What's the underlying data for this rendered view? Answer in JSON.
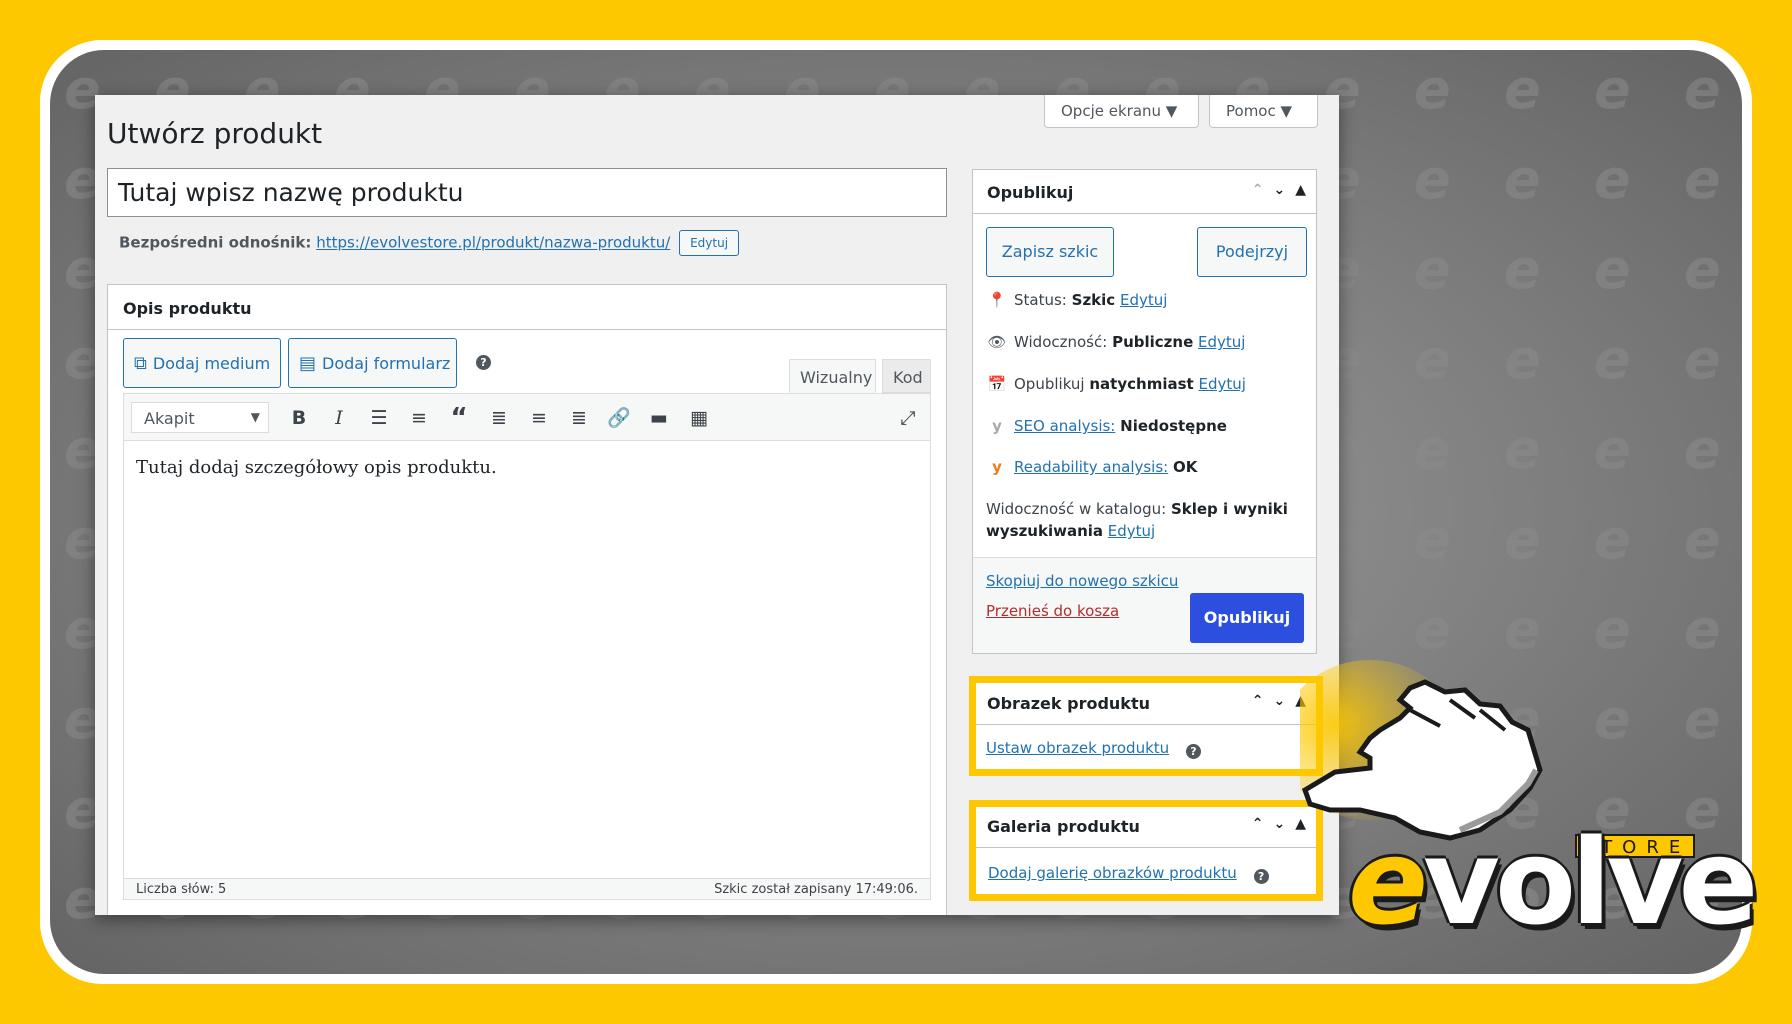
{
  "screen_options": {
    "screen_options_label": "Opcje ekranu ▼",
    "help_label": "Pomoc ▼"
  },
  "page": {
    "title": "Utwórz produkt"
  },
  "product": {
    "title_placeholder": "Tutaj wpisz nazwę produktu",
    "permalink_label": "Bezpośredni odnośnik:",
    "permalink_url": "https://evolvestore.pl/produkt/nazwa-produktu/",
    "permalink_edit": "Edytuj"
  },
  "description": {
    "heading": "Opis produktu",
    "add_media": "Dodaj medium",
    "add_form": "Dodaj formularz",
    "tab_visual": "Wizualny",
    "tab_code": "Kod",
    "format_value": "Akapit",
    "content": "Tutaj dodaj szczegółowy opis produktu.",
    "word_count": "Liczba słów: 5",
    "saved_status": "Szkic został zapisany 17:49:06."
  },
  "publish": {
    "heading": "Opublikuj",
    "save_draft": "Zapisz szkic",
    "preview": "Podejrzyj",
    "status_label": "Status:",
    "status_value": "Szkic",
    "visibility_label": "Widoczność:",
    "visibility_value": "Publiczne",
    "schedule_label": "Opublikuj",
    "schedule_value": "natychmiast",
    "seo_link": "SEO analysis:",
    "seo_value": "Niedostępne",
    "readability_link": "Readability analysis:",
    "readability_value": "OK",
    "catalog_label": "Widoczność w katalogu:",
    "catalog_value_1": "Sklep i wyniki",
    "catalog_value_2": "wyszukiwania",
    "edit": "Edytuj",
    "copy_draft": "Skopiuj do nowego szkicu",
    "trash": "Przenieś do kosza",
    "publish_button": "Opublikuj"
  },
  "product_image": {
    "heading": "Obrazek produktu",
    "set_link": "Ustaw obrazek produktu"
  },
  "product_gallery": {
    "heading": "Galeria produktu",
    "add_link": "Dodaj galerię obrazków produktu"
  },
  "brand": {
    "store": "STORE",
    "word_e": "e",
    "word_rest": "volve"
  },
  "colors": {
    "brand_yellow": "#fdc800",
    "wp_link": "#2271b1",
    "publish_blue": "#2c4fe0",
    "trash_red": "#b32d2e"
  }
}
